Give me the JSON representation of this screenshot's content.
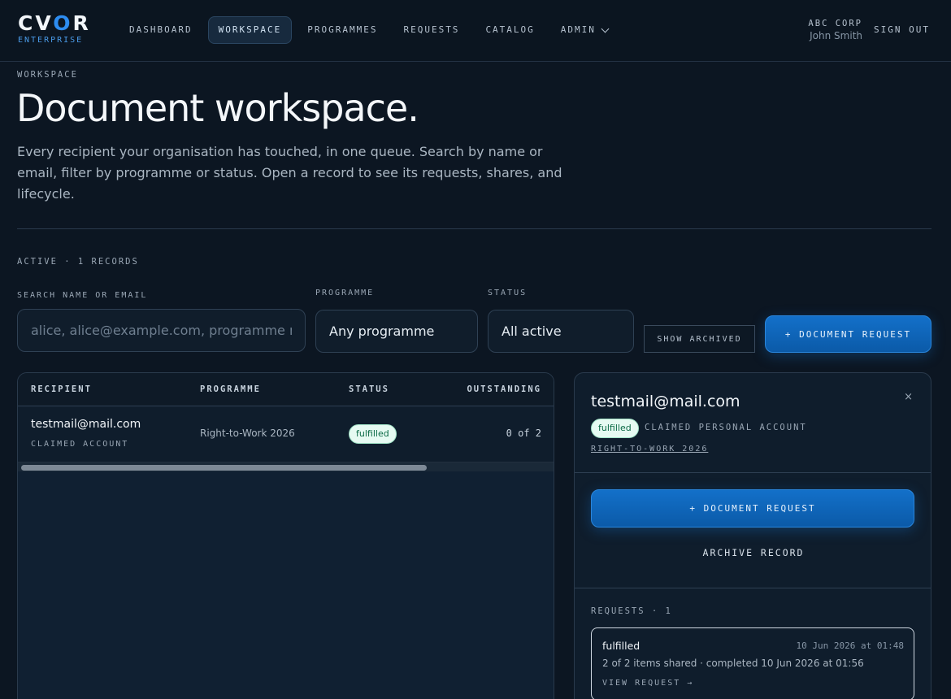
{
  "brand": {
    "name_pre": "CV",
    "name_o": "O",
    "name_post": "R",
    "subtitle": "ENTERPRISE",
    "accent": "#2d8cf0"
  },
  "nav": {
    "items": [
      "DASHBOARD",
      "WORKSPACE",
      "PROGRAMMES",
      "REQUESTS",
      "CATALOG",
      "ADMIN"
    ],
    "active": "WORKSPACE"
  },
  "user": {
    "org": "ABC CORP",
    "name": "John Smith",
    "signout": "SIGN OUT"
  },
  "page": {
    "eyebrow": "WORKSPACE",
    "title": "Document workspace.",
    "intro": "Every recipient your organisation has touched, in one queue. Search by name or email, filter by programme or status. Open a record to see its requests, shares, and lifecycle.",
    "count": "ACTIVE · 1 RECORDS"
  },
  "filters": {
    "search_label": "SEARCH NAME OR EMAIL",
    "search_placeholder": "alice, alice@example.com, programme name",
    "programme_label": "PROGRAMME",
    "programme_value": "Any programme",
    "status_label": "STATUS",
    "status_value": "All active",
    "show_archived": "SHOW ARCHIVED",
    "new_request": "+ DOCUMENT REQUEST"
  },
  "table": {
    "columns": [
      "RECIPIENT",
      "PROGRAMME",
      "STATUS",
      "OUTSTANDING"
    ],
    "rows": [
      {
        "email": "testmail@mail.com",
        "account": "CLAIMED ACCOUNT",
        "programme": "Right-to-Work 2026",
        "status": "fulfilled",
        "outstanding": "0 of 2"
      }
    ]
  },
  "detail": {
    "email": "testmail@mail.com",
    "close": "×",
    "status": "fulfilled",
    "account": "CLAIMED PERSONAL ACCOUNT",
    "programme": "RIGHT-TO-WORK 2026",
    "new_request": "+ DOCUMENT REQUEST",
    "archive": "ARCHIVE RECORD",
    "requests_label": "REQUESTS · 1",
    "requests": [
      {
        "status": "fulfilled",
        "date": "10 Jun 2026 at 01:48",
        "detail": "2 of 2 items shared · completed 10 Jun 2026 at 01:56",
        "link": "VIEW REQUEST →"
      }
    ]
  }
}
